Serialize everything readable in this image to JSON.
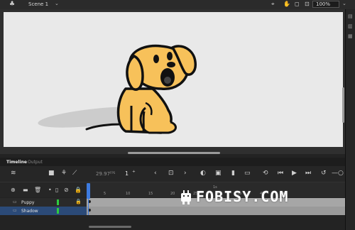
{
  "topbar": {
    "scene_label": "Scene 1",
    "zoom_value": "100%"
  },
  "timeline": {
    "tab_active": "Timeline",
    "tab_other": "Output",
    "fps_value": "29.97",
    "fps_unit": "FPS",
    "current_frame": "1",
    "ruler_ticks": [
      "1s",
      "5",
      "10",
      "15",
      "20",
      "25",
      "30",
      "35",
      "40",
      "45"
    ]
  },
  "layers": [
    {
      "name": "Puppy"
    },
    {
      "name": "Shadow"
    }
  ],
  "watermark": {
    "text": "FOBISY.COM"
  },
  "colors": {
    "stage": "#e9e9e9",
    "dog_fill": "#f7c15a",
    "layer_highlight": "#2b4a78",
    "playhead": "#3d7be0",
    "layer_color": "#2ecc40"
  }
}
